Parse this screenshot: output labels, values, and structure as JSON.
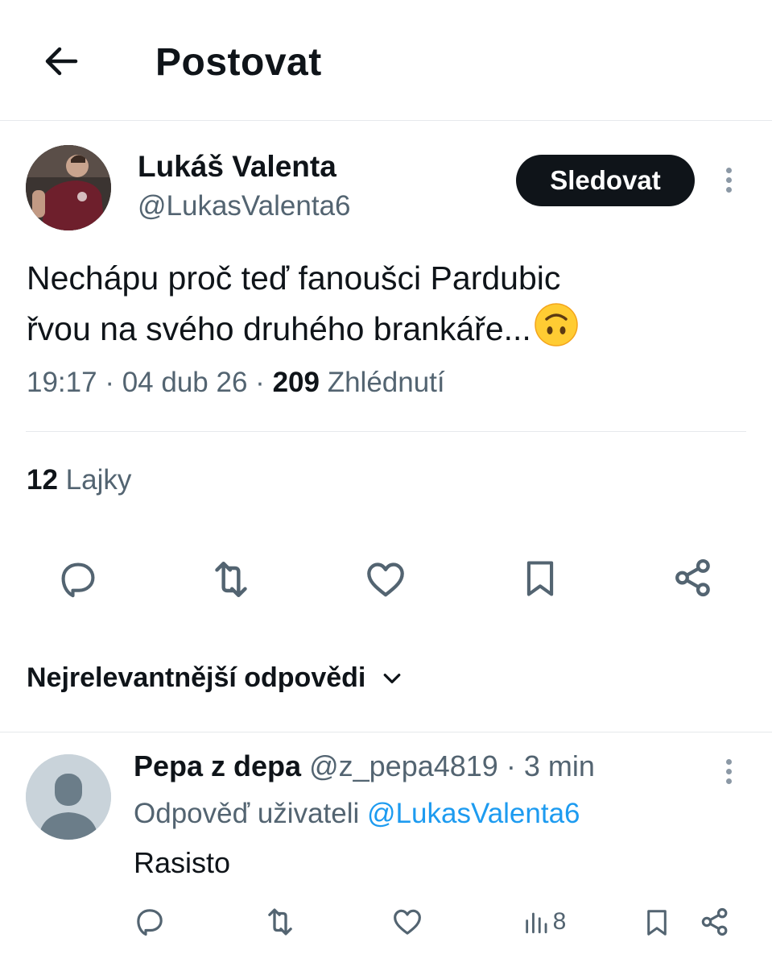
{
  "header": {
    "title": "Postovat"
  },
  "tweet": {
    "author_name": "Lukáš Valenta",
    "author_handle": "@LukasValenta6",
    "follow_label": "Sledovat",
    "text_line1": "Nechápu proč teď fanoušci Pardubic",
    "text_line2": "řvou na svého druhého brankáře...",
    "emoji": "upside-down-face-emoji",
    "time": "19:17",
    "date": "04 dub 26",
    "separator": "·",
    "views_count": "209",
    "views_label": "Zhlédnutí",
    "likes_count": "12",
    "likes_label": "Lajky"
  },
  "actions": [
    "reply-icon",
    "retweet-icon",
    "like-icon",
    "bookmark-icon",
    "share-icon"
  ],
  "replies_section": {
    "sort_label": "Nejrelevantnější odpovědi"
  },
  "reply": {
    "name": "Pepa z depa",
    "handle": "@z_pepa4819",
    "separator": "·",
    "time": "3 min",
    "reply_to_label": "Odpověď uživateli",
    "reply_to_handle": "@LukasValenta6",
    "text": "Rasisto",
    "views_count": "8"
  },
  "colors": {
    "text_primary": "#0f1419",
    "text_secondary": "#536471",
    "link": "#1d9bf0",
    "follow_bg": "#0f1419",
    "divider": "#e6e9ec"
  }
}
